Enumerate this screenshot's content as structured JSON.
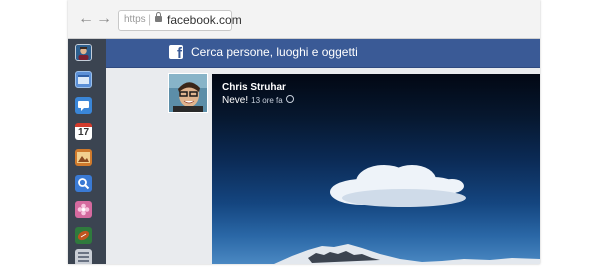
{
  "browser": {
    "back_icon": "back-arrow-icon",
    "forward_icon": "forward-arrow-icon",
    "scheme": "https",
    "host": "facebook.com"
  },
  "sidebar": {
    "apps": [
      {
        "name": "avatar"
      },
      {
        "name": "finder-icon",
        "color": "#5b8fd6"
      },
      {
        "name": "messages-icon",
        "color": "#3a86d8"
      },
      {
        "name": "calendar-icon",
        "label": "17",
        "color": "#ffffff"
      },
      {
        "name": "photos-icon",
        "color": "#d07a2c"
      },
      {
        "name": "search-icon",
        "color": "#3a7ad4"
      },
      {
        "name": "flower-icon",
        "color": "#d56a9f"
      },
      {
        "name": "ball-icon",
        "color": "#c0541f"
      },
      {
        "name": "list-icon",
        "color": "#c9ced6"
      }
    ]
  },
  "header": {
    "logo": "f",
    "search_placeholder": "Cerca persone, luoghi e oggetti",
    "brand_color": "#3a5a96"
  },
  "post": {
    "author": "Chris Struhar",
    "text": "Neve!",
    "time": "13 ore fa"
  }
}
